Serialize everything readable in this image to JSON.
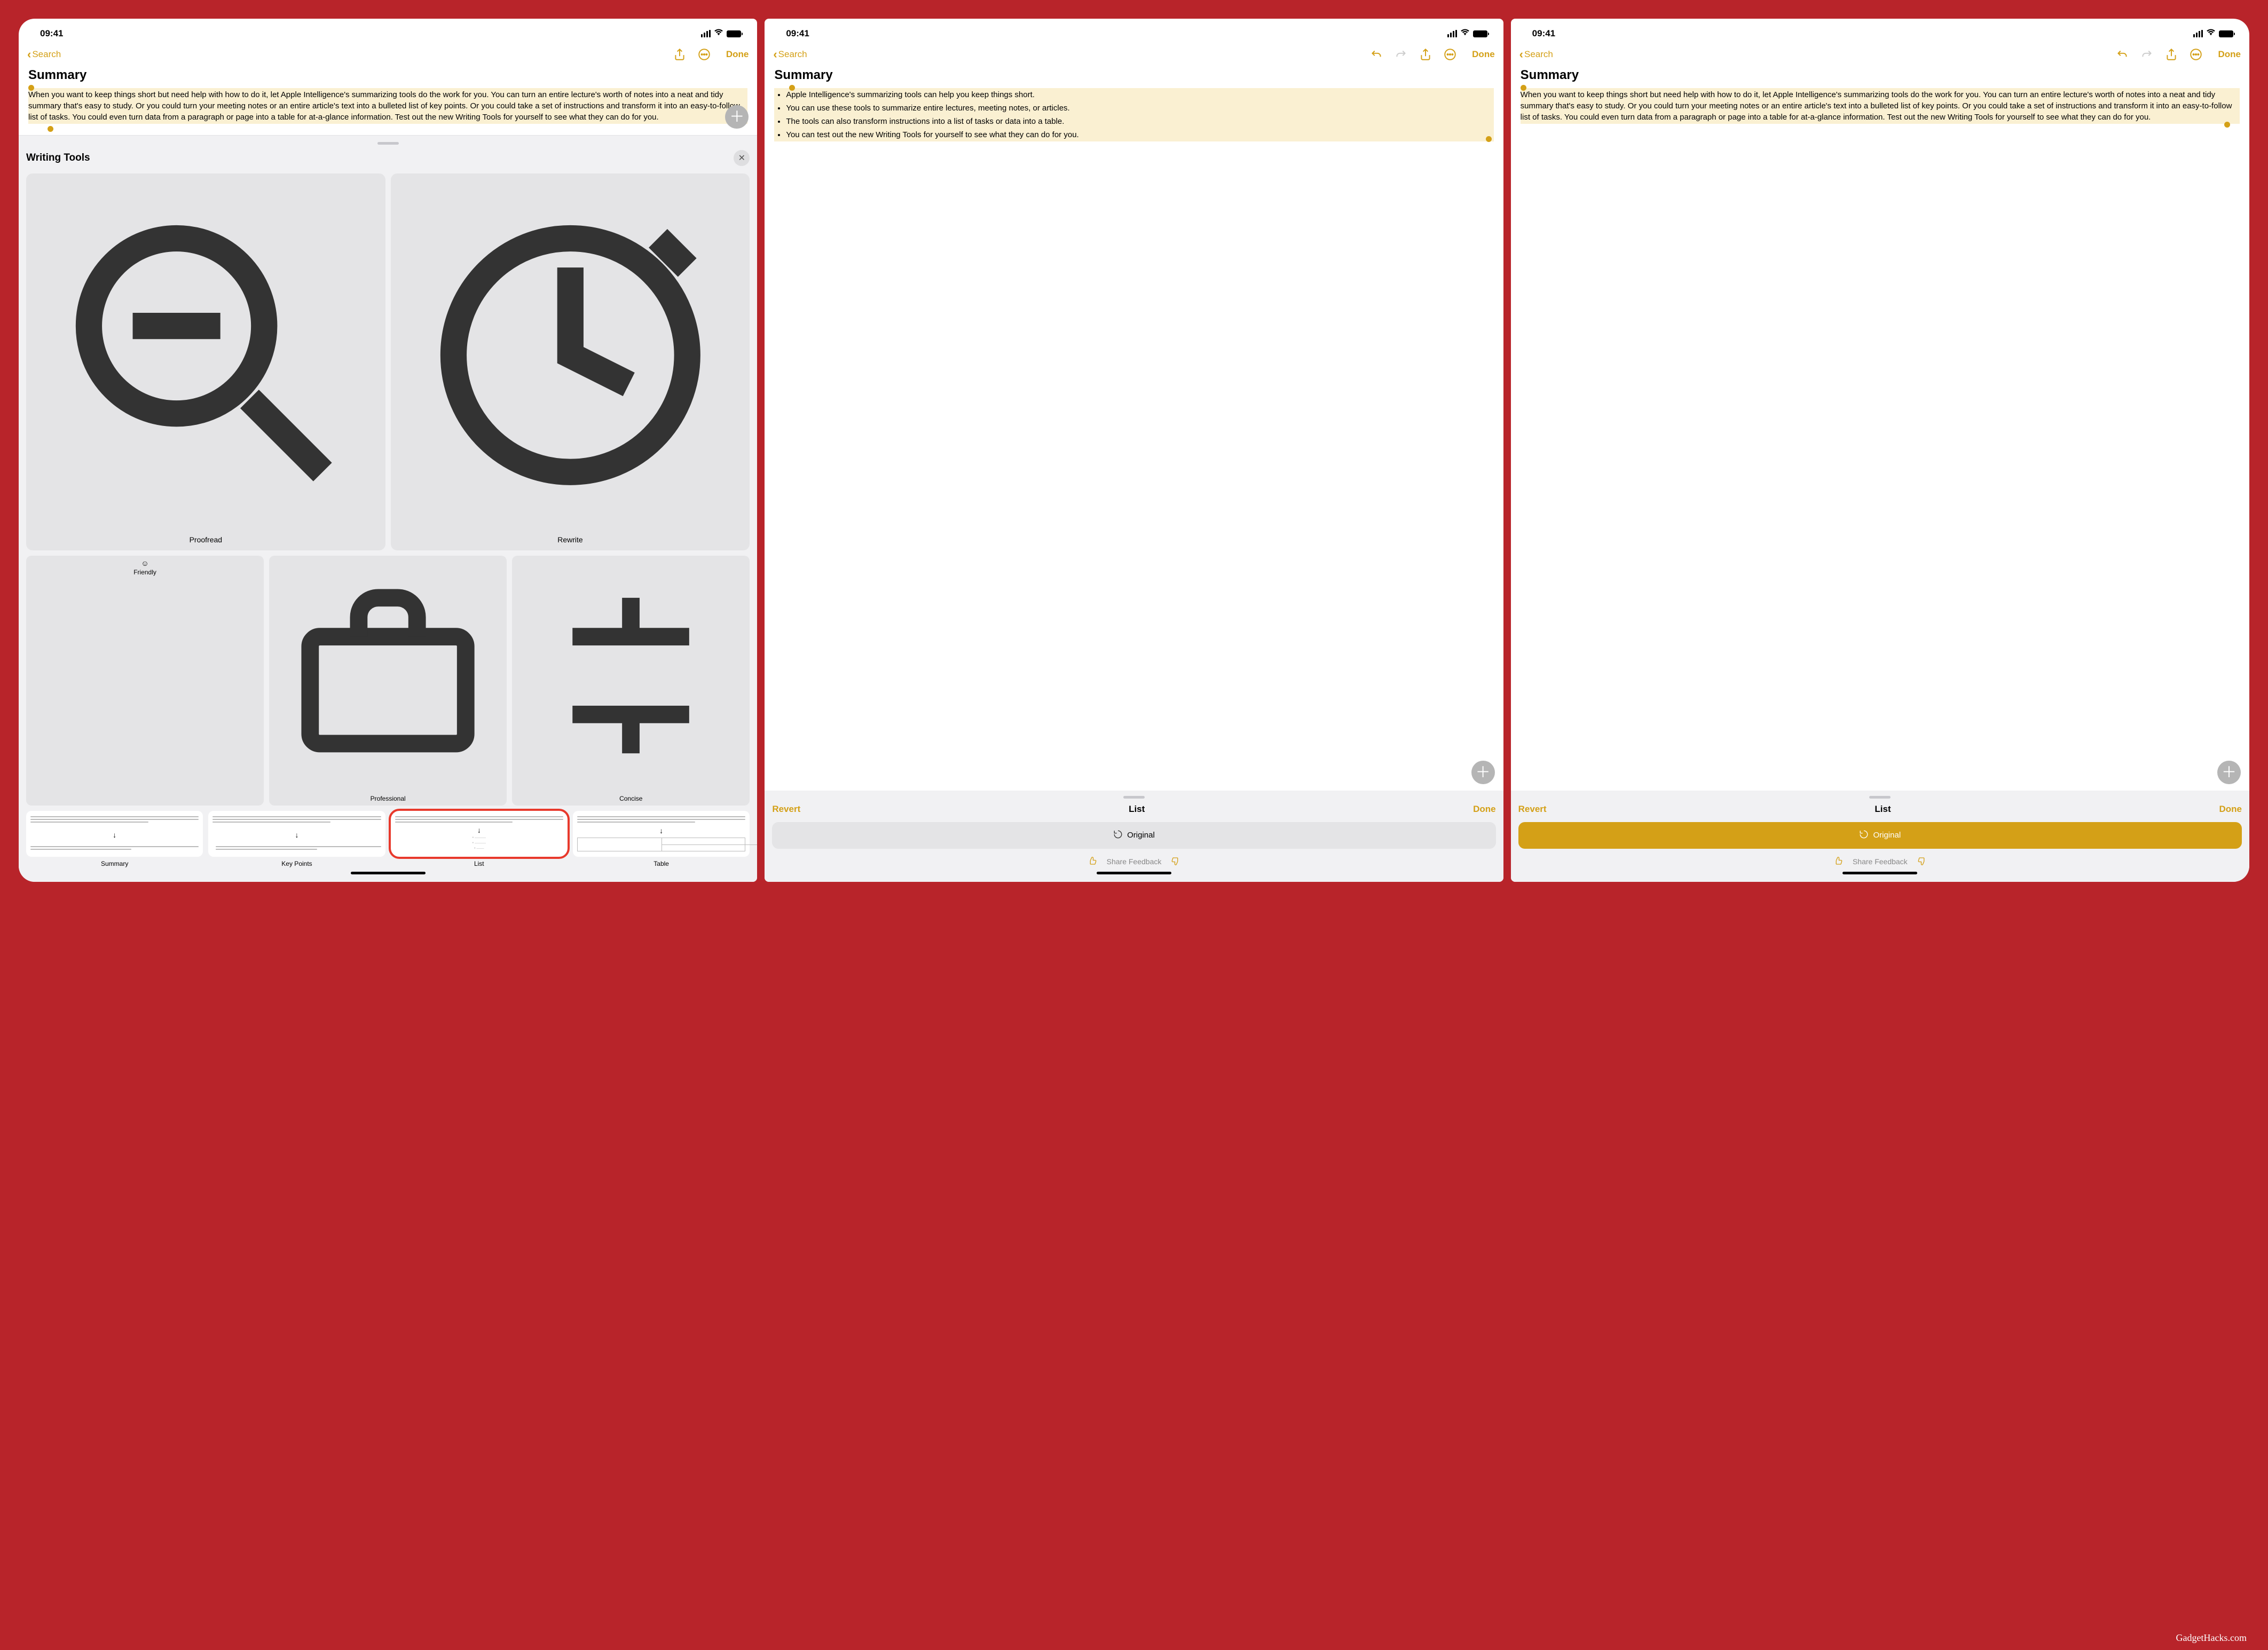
{
  "status": {
    "time": "09:41"
  },
  "nav": {
    "back_label": "Search",
    "done_label": "Done"
  },
  "note": {
    "title": "Summary",
    "paragraph": "When you want to keep things short but need help with how to do it, let Apple Intelligence's summarizing tools do the work for you. You can turn an entire lecture's worth of notes into a neat and tidy summary that's easy to study. Or you could turn your meeting notes or an entire article's text into a bulleted list of key points. Or you could take a set of instructions and transform it into an easy-to-follow list of tasks. You could even turn data from a paragraph or page into a table for at-a-glance information. Test out the new Writing Tools for yourself to see what they can do for you.",
    "bullets": [
      "Apple Intelligence's summarizing tools can help you keep things short.",
      "You can use these tools to summarize entire lectures, meeting notes, or articles.",
      "The tools can also transform instructions into a list of tasks or data into a table.",
      "You can test out the new Writing Tools for yourself to see what they can do for you."
    ]
  },
  "writing_tools": {
    "title": "Writing Tools",
    "proofread": "Proofread",
    "rewrite": "Rewrite",
    "friendly": "Friendly",
    "professional": "Professional",
    "concise": "Concise",
    "formats": {
      "summary": "Summary",
      "key_points": "Key Points",
      "list": "List",
      "table": "Table"
    }
  },
  "result": {
    "revert": "Revert",
    "title": "List",
    "done": "Done",
    "original": "Original",
    "share_feedback": "Share Feedback"
  },
  "watermark": "GadgetHacks.com"
}
